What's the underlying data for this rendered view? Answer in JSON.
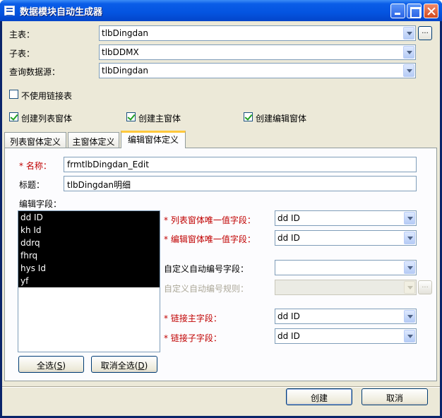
{
  "window": {
    "title": "数据模块自动生成器"
  },
  "form": {
    "main_table": {
      "label": "主表：",
      "value": "tlbDingdan"
    },
    "sub_table": {
      "label": "子表：",
      "value": "tlbDDMX"
    },
    "query_source": {
      "label": "查询数据源：",
      "value": "tlbDingdan"
    },
    "ellipsis": "..."
  },
  "options": {
    "no_link_table": {
      "label": "不使用链接表",
      "checked": false
    },
    "create_list_form": {
      "label": "创建列表窗体",
      "checked": true
    },
    "create_main_form": {
      "label": "创建主窗体",
      "checked": true
    },
    "create_edit_form": {
      "label": "创建编辑窗体",
      "checked": true
    }
  },
  "tabs": [
    {
      "label": "列表窗体定义",
      "active": false
    },
    {
      "label": "主窗体定义",
      "active": false
    },
    {
      "label": "编辑窗体定义",
      "active": true
    }
  ],
  "edit_tab": {
    "name_label": "* 名称：",
    "name_value": "frmtlbDingdan_Edit",
    "caption_label": "标题：",
    "caption_value": "tlbDingdan明细",
    "fields_label": "编辑字段：",
    "fields": [
      "dd ID",
      "kh Id",
      "ddrq",
      "fhrq",
      "hys Id",
      "yf"
    ],
    "list_unique_label": "* 列表窗体唯一值字段：",
    "list_unique_value": "dd ID",
    "edit_unique_label": "* 编辑窗体唯一值字段：",
    "edit_unique_value": "dd ID",
    "auto_num_label": "自定义自动编号字段：",
    "auto_num_value": "",
    "auto_rule_label": "自定义自动编号规则：",
    "auto_rule_value": "",
    "link_main_label": "* 链接主字段：",
    "link_main_value": "dd ID",
    "link_sub_label": "* 链接子字段：",
    "link_sub_value": "dd ID",
    "select_all": {
      "text": "全选(",
      "key": "S",
      "end": ")"
    },
    "deselect_all": {
      "text": "取消全选(",
      "key": "D",
      "end": ")"
    }
  },
  "footer": {
    "create": "创建",
    "cancel": "取消"
  },
  "colors": {
    "titlebar": "#0454e0",
    "required": "#c00000",
    "face": "#ece9d8",
    "tab_highlight": "#ffc83c"
  }
}
